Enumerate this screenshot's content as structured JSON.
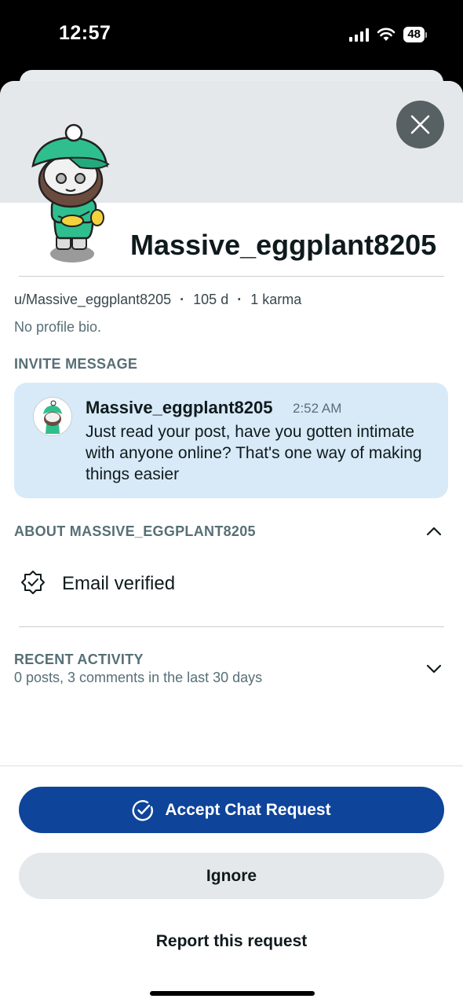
{
  "status_bar": {
    "time": "12:57",
    "battery": "48"
  },
  "profile": {
    "username": "Massive_eggplant8205",
    "handle": "u/Massive_eggplant8205",
    "age": "105 d",
    "karma": "1 karma",
    "bio": "No profile bio."
  },
  "invite": {
    "section_label": "INVITE MESSAGE",
    "sender": "Massive_eggplant8205",
    "time": "2:52 AM",
    "message": "Just read your post, have you gotten intimate with anyone online? That's one way of making things easier"
  },
  "about": {
    "section_label": "ABOUT MASSIVE_EGGPLANT8205",
    "email_verified": "Email verified"
  },
  "activity": {
    "section_label": "RECENT ACTIVITY",
    "summary": "0 posts, 3 comments in the last 30 days"
  },
  "actions": {
    "accept": "Accept Chat Request",
    "ignore": "Ignore",
    "report": "Report this request"
  },
  "colors": {
    "accent": "#0e4499",
    "invite_bg": "#d8eaf8",
    "banner": "#e4e8eb",
    "avatar_green": "#2fbf8f"
  },
  "icons": {
    "close": "close-icon",
    "chevron_up": "chevron-up-icon",
    "chevron_down": "chevron-down-icon",
    "verified": "verified-badge-icon",
    "accept": "check-circle-icon"
  }
}
